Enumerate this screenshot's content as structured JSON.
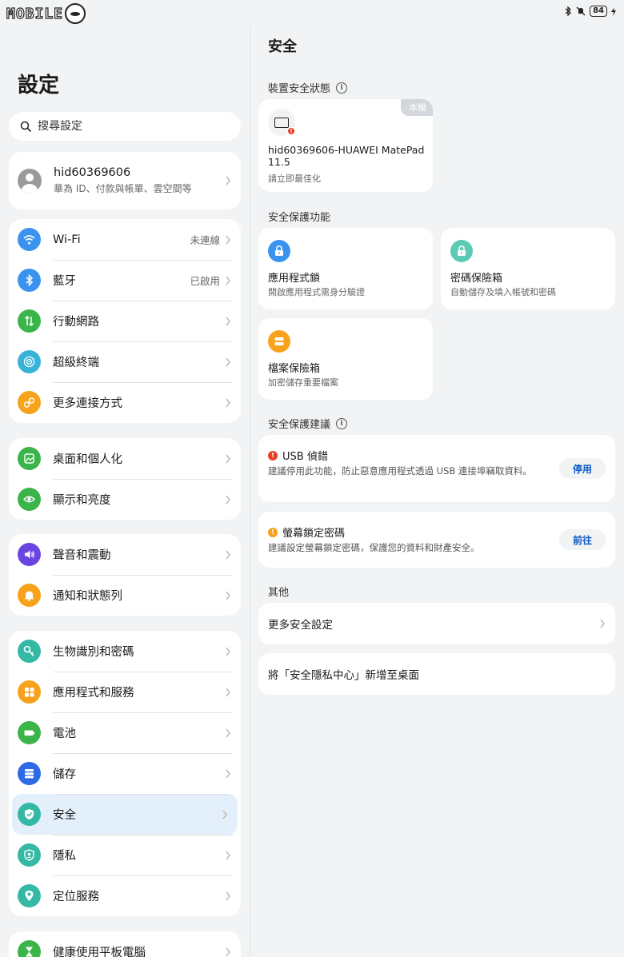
{
  "statusbar": {
    "logo_text": "MOBILE",
    "battery": "84"
  },
  "left": {
    "title": "設定",
    "search_placeholder": "搜尋設定",
    "account": {
      "name": "hid60369606",
      "sub": "華為 ID、付款與帳單、雲空間等"
    },
    "groups": [
      [
        {
          "label": "Wi-Fi",
          "value": "未連線",
          "icon": "wifi-icon",
          "color": "#3b93f0"
        },
        {
          "label": "藍牙",
          "value": "已啟用",
          "icon": "bluetooth-icon",
          "color": "#3b93f0"
        },
        {
          "label": "行動網路",
          "value": "",
          "icon": "mobile-data-icon",
          "color": "#3bb54a"
        },
        {
          "label": "超級終端",
          "value": "",
          "icon": "super-device-icon",
          "color": "#38b3d8"
        },
        {
          "label": "更多連接方式",
          "value": "",
          "icon": "link-icon",
          "color": "#f7a21b"
        }
      ],
      [
        {
          "label": "桌面和個人化",
          "value": "",
          "icon": "wallpaper-icon",
          "color": "#3bb54a"
        },
        {
          "label": "顯示和亮度",
          "value": "",
          "icon": "eye-icon",
          "color": "#3bb54a"
        }
      ],
      [
        {
          "label": "聲音和震動",
          "value": "",
          "icon": "speaker-icon",
          "color": "#6b45e0"
        },
        {
          "label": "通知和狀態列",
          "value": "",
          "icon": "bell-icon",
          "color": "#f7a21b"
        }
      ],
      [
        {
          "label": "生物識別和密碼",
          "value": "",
          "icon": "key-icon",
          "color": "#35b8a6"
        },
        {
          "label": "應用程式和服務",
          "value": "",
          "icon": "apps-icon",
          "color": "#f7a21b"
        },
        {
          "label": "電池",
          "value": "",
          "icon": "battery-icon",
          "color": "#3bb54a"
        },
        {
          "label": "儲存",
          "value": "",
          "icon": "storage-icon",
          "color": "#2c6ae6"
        },
        {
          "label": "安全",
          "value": "",
          "icon": "shield-check-icon",
          "color": "#35b8a6",
          "active": true
        },
        {
          "label": "隱私",
          "value": "",
          "icon": "privacy-icon",
          "color": "#35b8a6"
        },
        {
          "label": "定位服務",
          "value": "",
          "icon": "location-icon",
          "color": "#35b8a6"
        }
      ],
      [
        {
          "label": "健康使用平板電腦",
          "value": "",
          "icon": "hourglass-icon",
          "color": "#3bb54a"
        }
      ]
    ]
  },
  "right": {
    "title": "安全",
    "device_section": "裝置安全狀態",
    "device": {
      "badge": "本機",
      "name": "hid60369606-HUAWEI MatePad 11.5",
      "sub": "請立即最佳化"
    },
    "feature_section": "安全保護功能",
    "features": [
      {
        "name": "應用程式鎖",
        "sub": "開啟應用程式需身分驗證",
        "icon": "lock-icon",
        "color": "#3b93f0"
      },
      {
        "name": "密碼保險箱",
        "sub": "自動儲存及填入帳號和密碼",
        "icon": "password-lock-icon",
        "color": "#5ccab5"
      },
      {
        "name": "檔案保險箱",
        "sub": "加密儲存重要檔案",
        "icon": "file-safe-icon",
        "color": "#f7a21b"
      }
    ],
    "suggest_section": "安全保護建議",
    "suggestions": [
      {
        "title": "USB 偵錯",
        "sub": "建議停用此功能，防止惡意應用程式透過 USB 連接埠竊取資料。",
        "button": "停用",
        "color": "#e84026"
      },
      {
        "title": "螢幕鎖定密碼",
        "sub": "建議設定螢幕鎖定密碼，保護您的資料和財產安全。",
        "button": "前往",
        "color": "#f7a21b"
      }
    ],
    "other_section": "其他",
    "other": [
      {
        "label": "更多安全設定"
      },
      {
        "label": "將「安全隱私中心」新增至桌面"
      }
    ]
  }
}
